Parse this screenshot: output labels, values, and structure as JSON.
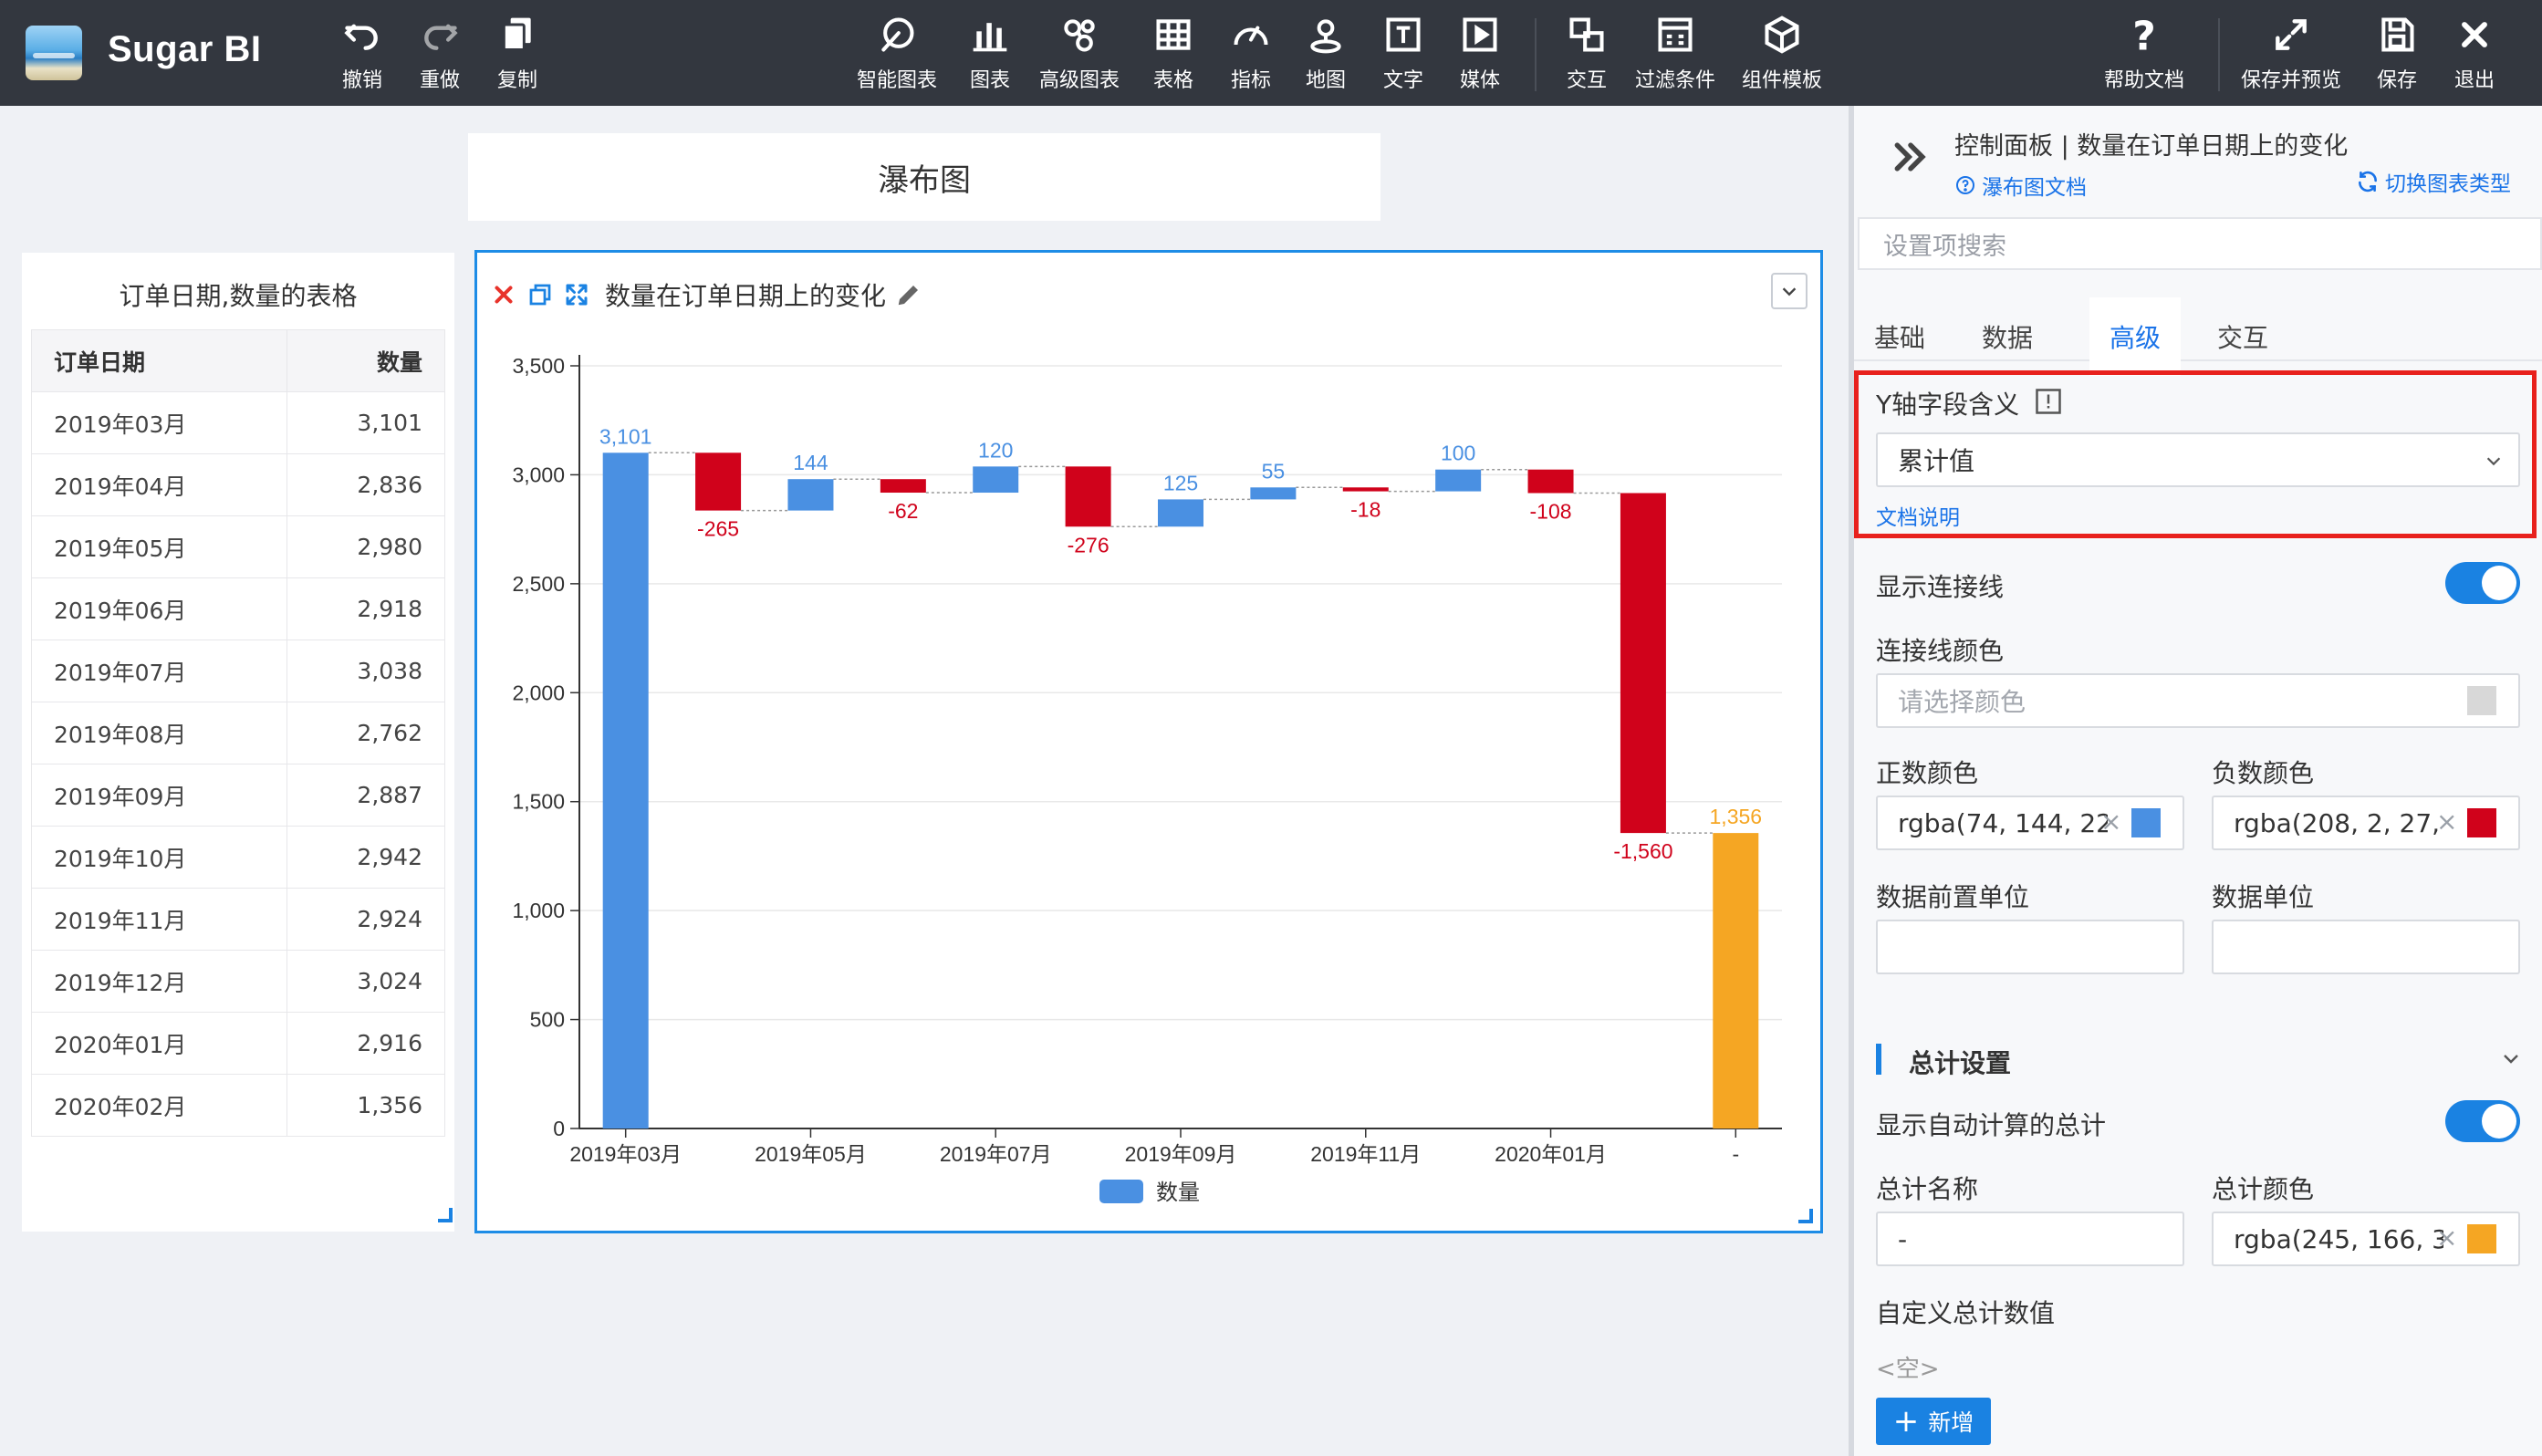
{
  "app": {
    "title": "Sugar BI"
  },
  "toolbar": {
    "undo": "撤销",
    "redo": "重做",
    "copy": "复制",
    "smart_chart": "智能图表",
    "chart": "图表",
    "advanced_chart": "高级图表",
    "table": "表格",
    "indicator": "指标",
    "map": "地图",
    "text": "文字",
    "media": "媒体",
    "interaction": "交互",
    "filter": "过滤条件",
    "component_template": "组件模板",
    "help_doc": "帮助文档",
    "save_preview": "保存并预览",
    "save": "保存",
    "exit": "退出"
  },
  "page": {
    "title": "瀑布图"
  },
  "table_widget": {
    "title": "订单日期,数量的表格",
    "headers": [
      "订单日期",
      "数量"
    ],
    "rows": [
      [
        "2019年03月",
        "3,101"
      ],
      [
        "2019年04月",
        "2,836"
      ],
      [
        "2019年05月",
        "2,980"
      ],
      [
        "2019年06月",
        "2,918"
      ],
      [
        "2019年07月",
        "3,038"
      ],
      [
        "2019年08月",
        "2,762"
      ],
      [
        "2019年09月",
        "2,887"
      ],
      [
        "2019年10月",
        "2,942"
      ],
      [
        "2019年11月",
        "2,924"
      ],
      [
        "2019年12月",
        "3,024"
      ],
      [
        "2020年01月",
        "2,916"
      ],
      [
        "2020年02月",
        "1,356"
      ]
    ]
  },
  "chart_widget": {
    "title": "数量在订单日期上的变化"
  },
  "chart_data": {
    "type": "bar",
    "subtype": "waterfall",
    "categories": [
      "2019年03月",
      "2019年04月",
      "2019年05月",
      "2019年06月",
      "2019年07月",
      "2019年08月",
      "2019年09月",
      "2019年10月",
      "2019年11月",
      "2019年12月",
      "2020年01月",
      "2020年02月",
      "-"
    ],
    "values": [
      3101,
      2836,
      2980,
      2918,
      3038,
      2762,
      2887,
      2942,
      2924,
      3024,
      2916,
      1356,
      1356
    ],
    "changes": [
      3101,
      -265,
      144,
      -62,
      120,
      -276,
      125,
      55,
      -18,
      100,
      -108,
      -1560,
      1356
    ],
    "data_labels": [
      "3,101",
      "-265",
      "144",
      "-62",
      "120",
      "-276",
      "125",
      "55",
      "-18",
      "100",
      "-108",
      "-1,560",
      "1,356"
    ],
    "tick_labels": [
      "2019年03月",
      "2019年05月",
      "2019年07月",
      "2019年09月",
      "2019年11月",
      "2020年01月",
      "-"
    ],
    "y_ticks": [
      "0",
      "500",
      "1,000",
      "1,500",
      "2,000",
      "2,500",
      "3,000",
      "3,500"
    ],
    "ylim": [
      0,
      3500
    ],
    "grid": true,
    "connector_lines": true,
    "legend": {
      "position": "bottom",
      "entries": [
        "数量"
      ]
    },
    "colors": {
      "positive": "#4a90e2",
      "negative": "#d0021b",
      "total": "#f5a623"
    }
  },
  "panel": {
    "title": "控制面板 | 数量在订单日期上的变化",
    "doc_link": "瀑布图文档",
    "switch_link": "切换图表类型",
    "search_placeholder": "设置项搜索",
    "tabs": [
      "基础",
      "数据",
      "高级",
      "交互"
    ],
    "active_tab": "高级",
    "y_meaning_label": "Y轴字段含义",
    "y_meaning_value": "累计值",
    "doc_explain": "文档说明",
    "show_connector_label": "显示连接线",
    "connector_color_label": "连接线颜色",
    "connector_color_placeholder": "请选择颜色",
    "positive_color_label": "正数颜色",
    "positive_color_value": "rgba(74, 144, 22",
    "negative_color_label": "负数颜色",
    "negative_color_value": "rgba(208, 2, 27,",
    "prefix_unit_label": "数据前置单位",
    "unit_label": "数据单位",
    "total_section": "总计设置",
    "show_total_label": "显示自动计算的总计",
    "total_name_label": "总计名称",
    "total_name_value": "-",
    "total_color_label": "总计颜色",
    "total_color_value": "rgba(245, 166, 3",
    "custom_total_label": "自定义总计数值",
    "empty_text": "<空>",
    "add_button": "新增",
    "colors": {
      "positive": "#4a90e2",
      "negative": "#d0021b",
      "total": "#f5a623",
      "connector": "#d8d8d8"
    }
  }
}
